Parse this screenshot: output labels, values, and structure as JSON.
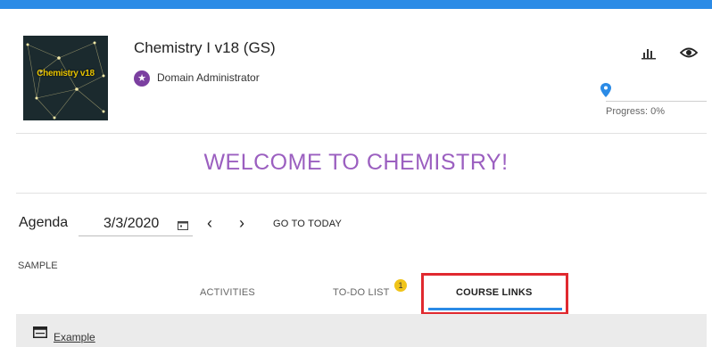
{
  "course": {
    "title": "Chemistry I v18 (GS)",
    "thumbnail_text": "Chemistry v18",
    "role": "Domain Administrator",
    "progress": {
      "label": "Progress: 0%",
      "value": 0
    }
  },
  "header_icons": [
    "stats-icon",
    "eye-icon",
    "location-pin-icon"
  ],
  "welcome": {
    "text": "WELCOME TO CHEMISTRY!"
  },
  "agenda": {
    "label": "Agenda",
    "date": "3/3/2020",
    "prev": "‹",
    "next": "›",
    "go_to_today": "GO TO TODAY"
  },
  "sample": {
    "label": "SAMPLE"
  },
  "tabs": [
    {
      "label": "ACTIVITIES",
      "active": false
    },
    {
      "label": "TO-DO LIST",
      "active": false,
      "badge": "1"
    },
    {
      "label": "COURSE LINKS",
      "active": true
    }
  ],
  "links": [
    {
      "label": "Example",
      "icon": "link-window-icon"
    }
  ],
  "colors": {
    "accent": "#2b8be6",
    "welcome": "#9b5fc0",
    "badge": "#f0c419",
    "highlight": "#e0292f",
    "role_badge": "#7b3fa0"
  }
}
